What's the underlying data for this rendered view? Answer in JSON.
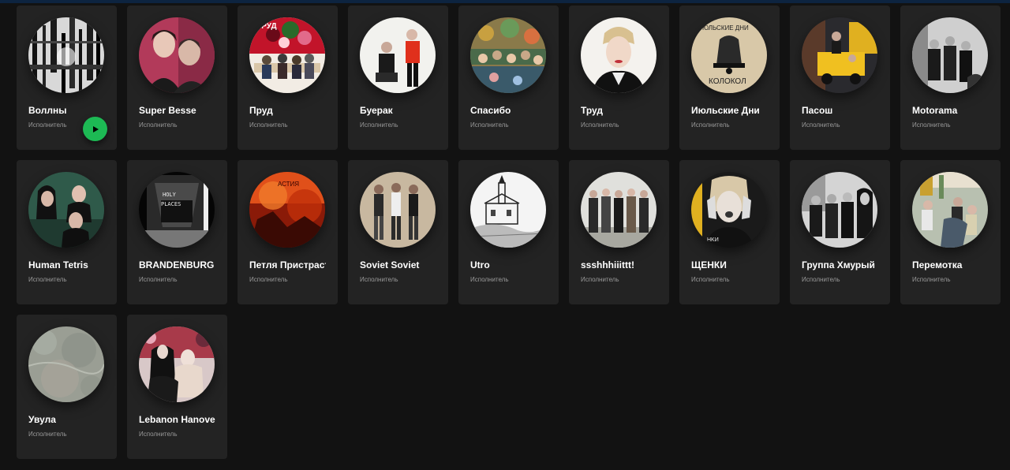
{
  "subtitle": "Исполнитель",
  "accent_color": "#1db954",
  "artists": [
    {
      "name": "Воллны",
      "subtitle": "Исполнитель",
      "hover_play": true,
      "art": "bw-texture"
    },
    {
      "name": "Super Besse",
      "subtitle": "Исполнитель",
      "art": "duo-red"
    },
    {
      "name": "Пруд",
      "subtitle": "Исполнитель",
      "art": "table-flowers"
    },
    {
      "name": "Буерак",
      "subtitle": "Исполнитель",
      "art": "two-men-white"
    },
    {
      "name": "Спасибо",
      "subtitle": "Исполнитель",
      "art": "party-colorful"
    },
    {
      "name": "Труд",
      "subtitle": "Исполнитель",
      "art": "woman-portrait"
    },
    {
      "name": "Июльские Дни",
      "subtitle": "Исполнитель",
      "art": "bell-drawing"
    },
    {
      "name": "Пасош",
      "subtitle": "Исполнитель",
      "art": "yellow-van"
    },
    {
      "name": "Motorama",
      "subtitle": "Исполнитель",
      "art": "bw-group"
    },
    {
      "name": "Human Tetris",
      "subtitle": "Исполнитель",
      "art": "green-trio"
    },
    {
      "name": "BRANDENBURG",
      "subtitle": "Исполнитель",
      "art": "holy-places"
    },
    {
      "name": "Петля Пристрастия",
      "subtitle": "Исполнитель",
      "art": "orange-concert"
    },
    {
      "name": "Soviet Soviet",
      "subtitle": "Исполнитель",
      "art": "trio-beige"
    },
    {
      "name": "Utro",
      "subtitle": "Исполнитель",
      "art": "church-sketch"
    },
    {
      "name": "ssshhhiiittt!",
      "subtitle": "Исполнитель",
      "art": "group-outdoor"
    },
    {
      "name": "ЩЕНКИ",
      "subtitle": "Исполнитель",
      "art": "girl-bw"
    },
    {
      "name": "Группа Хмурый",
      "subtitle": "Исполнитель",
      "art": "dark-group"
    },
    {
      "name": "Перемотка",
      "subtitle": "Исполнитель",
      "art": "street-group"
    },
    {
      "name": "Увула",
      "subtitle": "Исполнитель",
      "art": "grey-texture"
    },
    {
      "name": "Lebanon Hanover",
      "subtitle": "Исполнитель",
      "art": "couple-dark"
    }
  ]
}
